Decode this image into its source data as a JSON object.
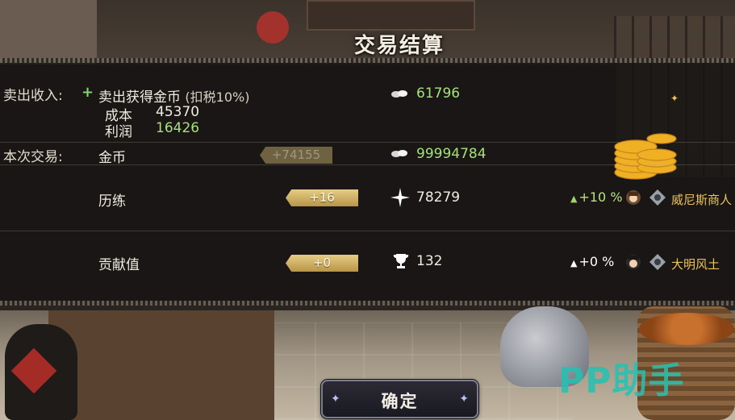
{
  "header": {
    "title": "交易结算"
  },
  "sale": {
    "section_label": "卖出收入:",
    "income_label": "卖出获得金币",
    "tax_note": "(扣税10%)",
    "income_value": "61796",
    "cost_label": "成本",
    "cost_value": "45370",
    "profit_label": "利润",
    "profit_value": "16426"
  },
  "trade": {
    "section_label": "本次交易:",
    "rows": [
      {
        "label": "金币",
        "delta": "+74155",
        "total": "99994784",
        "icon": "silver-coin-icon"
      },
      {
        "label": "历练",
        "delta": "+16",
        "total": "78279",
        "icon": "star-burst-icon",
        "bonus": "+10 %",
        "avatar": "merchant-avatar-icon",
        "rank_title": "威尼斯商人"
      },
      {
        "label": "贡献值",
        "delta": "+0",
        "total": "132",
        "icon": "trophy-icon",
        "bonus": "+0 %",
        "avatar": "scholar-avatar-icon",
        "rank_title": "大明风土"
      }
    ]
  },
  "footer": {
    "confirm_label": "确定"
  },
  "watermark": {
    "text": "PP助手"
  },
  "colors": {
    "accent_green": "#a4e279",
    "ribbon_gold": "#d4b56a",
    "rank_gold": "#ecc25a",
    "watermark": "#24c2b3"
  }
}
